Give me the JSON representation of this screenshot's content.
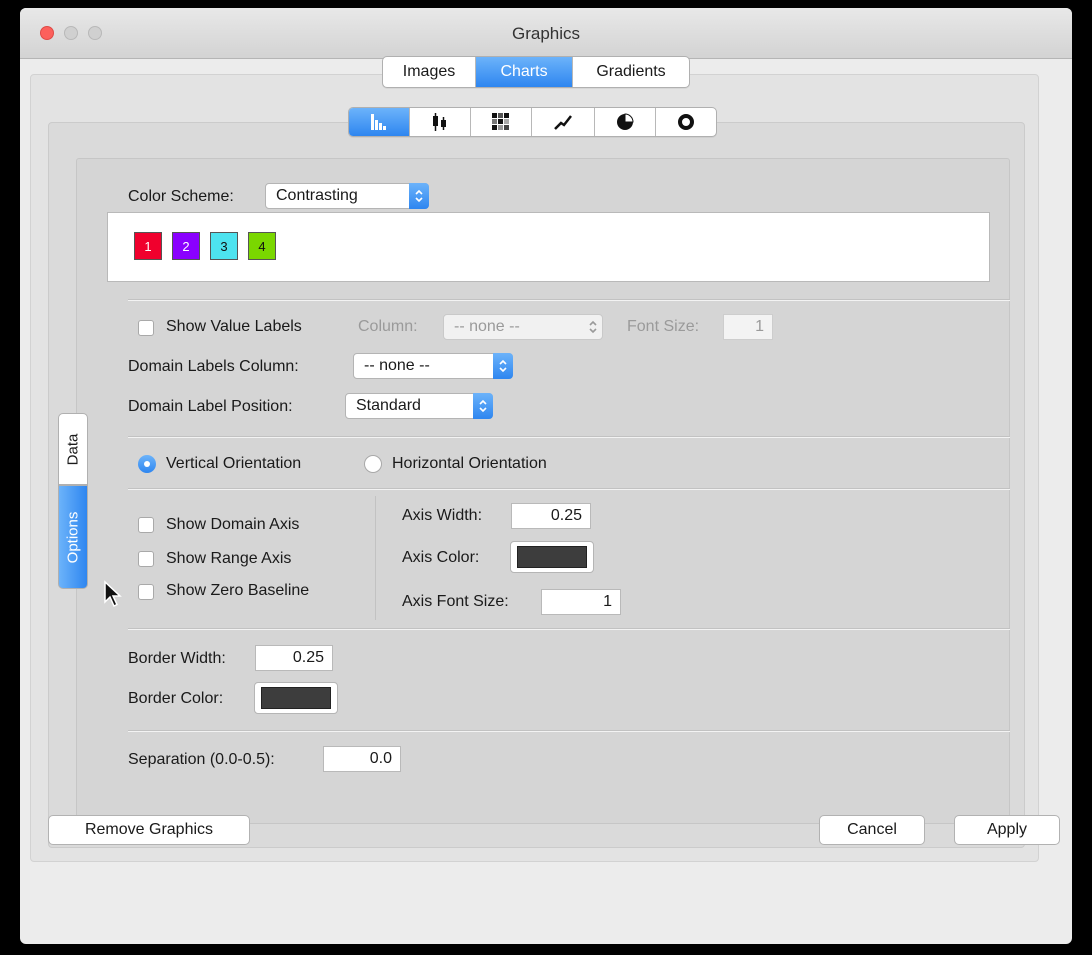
{
  "window": {
    "title": "Graphics"
  },
  "top_tabs": [
    {
      "label": "Images",
      "active": false
    },
    {
      "label": "Charts",
      "active": true
    },
    {
      "label": "Gradients",
      "active": false
    }
  ],
  "chart_type_tabs": [
    {
      "icon": "bar-chart-icon",
      "active": true
    },
    {
      "icon": "box-plot-icon",
      "active": false
    },
    {
      "icon": "heatmap-icon",
      "active": false
    },
    {
      "icon": "line-chart-icon",
      "active": false
    },
    {
      "icon": "pie-chart-icon",
      "active": false
    },
    {
      "icon": "ring-chart-icon",
      "active": false
    }
  ],
  "side_tabs": {
    "data": "Data",
    "options": "Options",
    "active": "Options"
  },
  "color_scheme": {
    "label": "Color Scheme:",
    "value": "Contrasting",
    "colors": [
      {
        "label": "1",
        "color": "#f0002d"
      },
      {
        "label": "2",
        "color": "#8a00ff"
      },
      {
        "label": "3",
        "color": "#4de3ef"
      },
      {
        "label": "4",
        "color": "#7ad700"
      }
    ]
  },
  "value_labels": {
    "checkbox_label": "Show Value Labels",
    "checked": false,
    "column_label": "Column:",
    "column_value": "-- none --",
    "font_size_label": "Font Size:",
    "font_size_value": "1"
  },
  "domain_labels_column": {
    "label": "Domain Labels Column:",
    "value": "-- none --"
  },
  "domain_label_position": {
    "label": "Domain Label Position:",
    "value": "Standard"
  },
  "orientation": {
    "vertical_label": "Vertical Orientation",
    "horizontal_label": "Horizontal Orientation",
    "selected": "vertical"
  },
  "axis": {
    "show_domain_axis": "Show Domain Axis",
    "show_range_axis": "Show Range Axis",
    "show_zero_baseline": "Show Zero Baseline",
    "width_label": "Axis Width:",
    "width_value": "0.25",
    "color_label": "Axis Color:",
    "color": "#3d3d3d",
    "font_size_label": "Axis Font Size:",
    "font_size_value": "1"
  },
  "border": {
    "width_label": "Border Width:",
    "width_value": "0.25",
    "color_label": "Border Color:",
    "color": "#3d3d3d"
  },
  "separation": {
    "label": "Separation (0.0-0.5):",
    "value": "0.0"
  },
  "buttons": {
    "remove": "Remove Graphics",
    "cancel": "Cancel",
    "apply": "Apply"
  },
  "accent_color": "#2e86f0"
}
